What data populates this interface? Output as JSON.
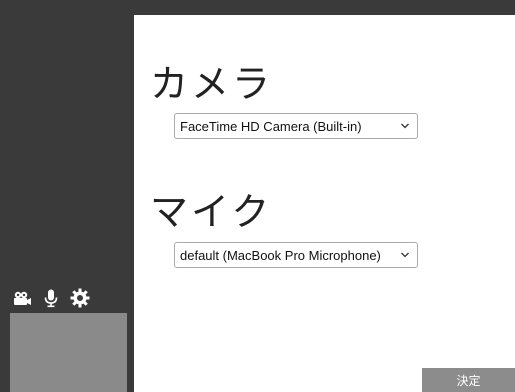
{
  "sidebar": {
    "icons": [
      "video-camera-icon",
      "microphone-icon",
      "gear-icon"
    ]
  },
  "main": {
    "camera": {
      "title": "カメラ",
      "selected": "FaceTime HD Camera (Built-in)"
    },
    "mic": {
      "title": "マイク",
      "selected": "default (MacBook Pro Microphone)"
    }
  },
  "footer": {
    "decide_label": "決定"
  },
  "colors": {
    "sidebar_bg": "#3a3a3a",
    "preview_bg": "#8a8a8a",
    "button_bg": "#8c8c8c",
    "page_bg": "#ffffff"
  }
}
